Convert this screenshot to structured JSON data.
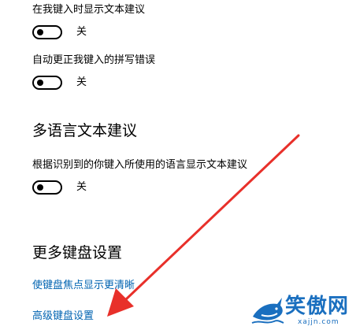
{
  "settings": {
    "suggest_as_type": {
      "label": "在我键入时显示文本建议",
      "state": "关",
      "on": false
    },
    "autocorrect": {
      "label": "自动更正我键入的拼写错误",
      "state": "关",
      "on": false
    }
  },
  "multilingual": {
    "heading": "多语言文本建议",
    "suggestion": {
      "label": "根据识别到的你键入所使用的语言显示文本建议",
      "state": "关",
      "on": false
    }
  },
  "more_keyboard": {
    "heading": "更多键盘设置",
    "links": [
      "使键盘焦点显示更清晰",
      "高级键盘设置"
    ]
  },
  "watermark": {
    "brand": "笑傲网",
    "domain": "xajjn.com"
  },
  "colors": {
    "link": "#0063b1",
    "arrow": "#e8302a",
    "watermark": "#1a6fbf"
  }
}
